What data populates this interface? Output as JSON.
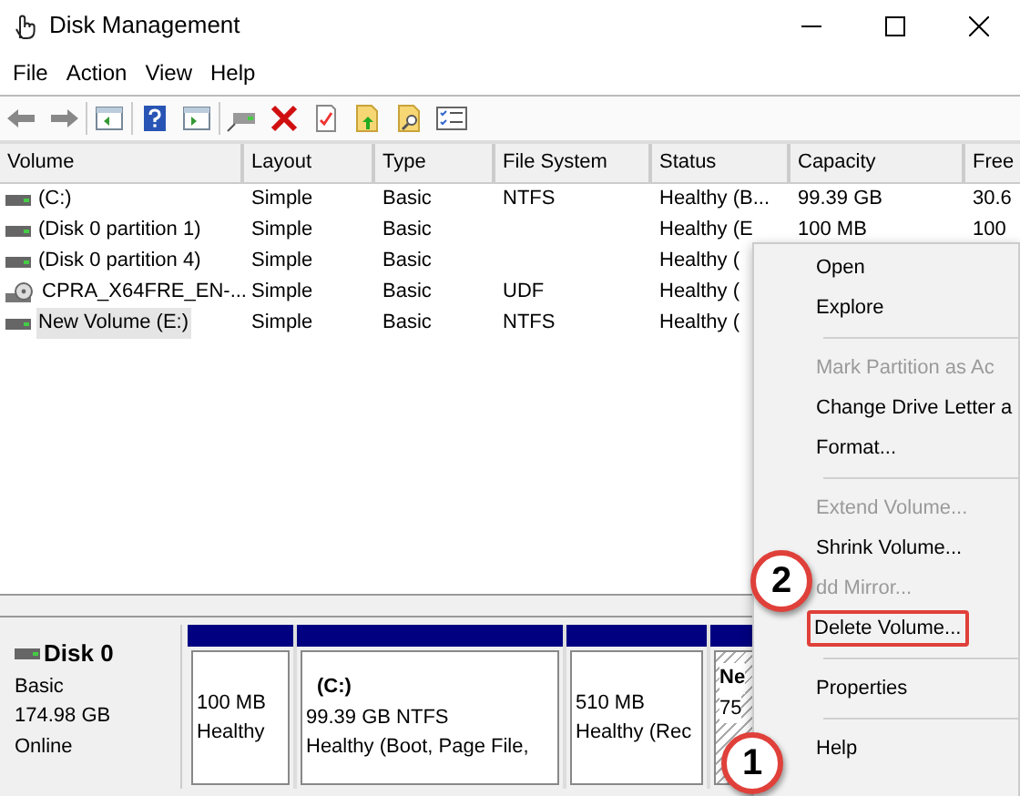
{
  "window": {
    "title": "Disk Management"
  },
  "menu_bar": [
    "File",
    "Action",
    "View",
    "Help"
  ],
  "volume_table": {
    "columns": [
      "Volume",
      "Layout",
      "Type",
      "File System",
      "Status",
      "Capacity",
      "Free"
    ],
    "rows": [
      {
        "kind": "disk",
        "selected": false,
        "cells": [
          "(C:)",
          "Simple",
          "Basic",
          "NTFS",
          "Healthy (B...",
          "99.39 GB",
          "30.6"
        ]
      },
      {
        "kind": "disk",
        "selected": false,
        "cells": [
          "(Disk 0 partition 1)",
          "Simple",
          "Basic",
          "",
          "Healthy (E",
          "100 MB",
          "100"
        ]
      },
      {
        "kind": "disk",
        "selected": false,
        "cells": [
          "(Disk 0 partition 4)",
          "Simple",
          "Basic",
          "",
          "Healthy (",
          "",
          ""
        ]
      },
      {
        "kind": "disc",
        "selected": false,
        "cells": [
          "CPRA_X64FRE_EN-...",
          "Simple",
          "Basic",
          "UDF",
          "Healthy (",
          "",
          ""
        ]
      },
      {
        "kind": "disk",
        "selected": true,
        "cells": [
          "New Volume (E:)",
          "Simple",
          "Basic",
          "NTFS",
          "Healthy (",
          "",
          ""
        ]
      }
    ]
  },
  "disk": {
    "name": "Disk 0",
    "type": "Basic",
    "size": "174.98 GB",
    "status": "Online",
    "partitions": [
      {
        "selected": false,
        "lines": [
          "100 MB",
          "Healthy"
        ]
      },
      {
        "selected": false,
        "title": "(C:)",
        "lines": [
          "99.39 GB NTFS",
          "Healthy (Boot, Page File,"
        ]
      },
      {
        "selected": false,
        "lines": [
          "510 MB",
          "Healthy (Rec"
        ]
      },
      {
        "selected": true,
        "title": "Ne",
        "lines": [
          "75"
        ]
      }
    ]
  },
  "context_menu": [
    {
      "kind": "item",
      "label": "Open",
      "disabled": false,
      "highlighted": false
    },
    {
      "kind": "item",
      "label": "Explore",
      "disabled": false,
      "highlighted": false
    },
    {
      "kind": "separator"
    },
    {
      "kind": "item",
      "label": "Mark Partition as Ac",
      "disabled": true,
      "highlighted": false
    },
    {
      "kind": "item",
      "label": "Change Drive Letter a",
      "disabled": false,
      "highlighted": false
    },
    {
      "kind": "item",
      "label": "Format...",
      "disabled": false,
      "highlighted": false
    },
    {
      "kind": "separator"
    },
    {
      "kind": "item",
      "label": "Extend Volume...",
      "disabled": true,
      "highlighted": false
    },
    {
      "kind": "item",
      "label": "Shrink Volume...",
      "disabled": false,
      "highlighted": false
    },
    {
      "kind": "item",
      "label": "dd Mirror...",
      "disabled": true,
      "highlighted": false
    },
    {
      "kind": "item",
      "label": "Delete Volume...",
      "disabled": false,
      "highlighted": true
    },
    {
      "kind": "separator"
    },
    {
      "kind": "item",
      "label": "Properties",
      "disabled": false,
      "highlighted": false
    },
    {
      "kind": "separator"
    },
    {
      "kind": "item",
      "label": "Help",
      "disabled": false,
      "highlighted": false
    }
  ],
  "callouts": [
    "1",
    "2"
  ]
}
